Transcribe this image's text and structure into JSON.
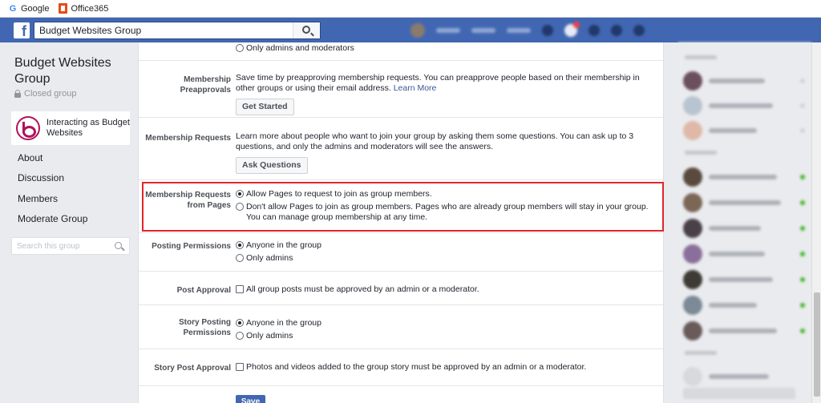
{
  "bookmarks": [
    {
      "label": "Google",
      "icon": "google-icon"
    },
    {
      "label": "Office365",
      "icon": "office365-icon"
    }
  ],
  "topbar": {
    "search_value": "Budget Websites Group",
    "color": "#4267b2"
  },
  "sidebar": {
    "group_name": "Budget Websites Group",
    "privacy": "Closed group",
    "interacting_as": "Interacting as Budget Websites",
    "nav": [
      "About",
      "Discussion",
      "Members",
      "Moderate Group"
    ],
    "search_placeholder": "Search this group"
  },
  "settings": {
    "top_option": "Only admins and moderators",
    "preapprovals": {
      "label": "Membership Preapprovals",
      "text": "Save time by preapproving membership requests. You can preapprove people based on their membership in other groups or using their email address.",
      "link": "Learn More",
      "button": "Get Started"
    },
    "requests": {
      "label": "Membership Requests",
      "text": "Learn more about people who want to join your group by asking them some questions. You can ask up to 3 questions, and only the admins and moderators will see the answers.",
      "button": "Ask Questions"
    },
    "from_pages": {
      "label": "Membership Requests from Pages",
      "options": [
        "Allow Pages to request to join as group members.",
        "Don't allow Pages to join as group members. Pages who are already group members will stay in your group. You can manage group membership at any time."
      ]
    },
    "posting": {
      "label": "Posting Permissions",
      "options": [
        "Anyone in the group",
        "Only admins"
      ]
    },
    "post_approval": {
      "label": "Post Approval",
      "text": "All group posts must be approved by an admin or a moderator."
    },
    "story_posting": {
      "label": "Story Posting Permissions",
      "options": [
        "Anyone in the group",
        "Only admins"
      ]
    },
    "story_approval": {
      "label": "Story Post Approval",
      "text": "Photos and videos added to the group story must be approved by an admin or a moderator."
    },
    "save_label": "Save",
    "highlight_color": "#e0262b"
  }
}
